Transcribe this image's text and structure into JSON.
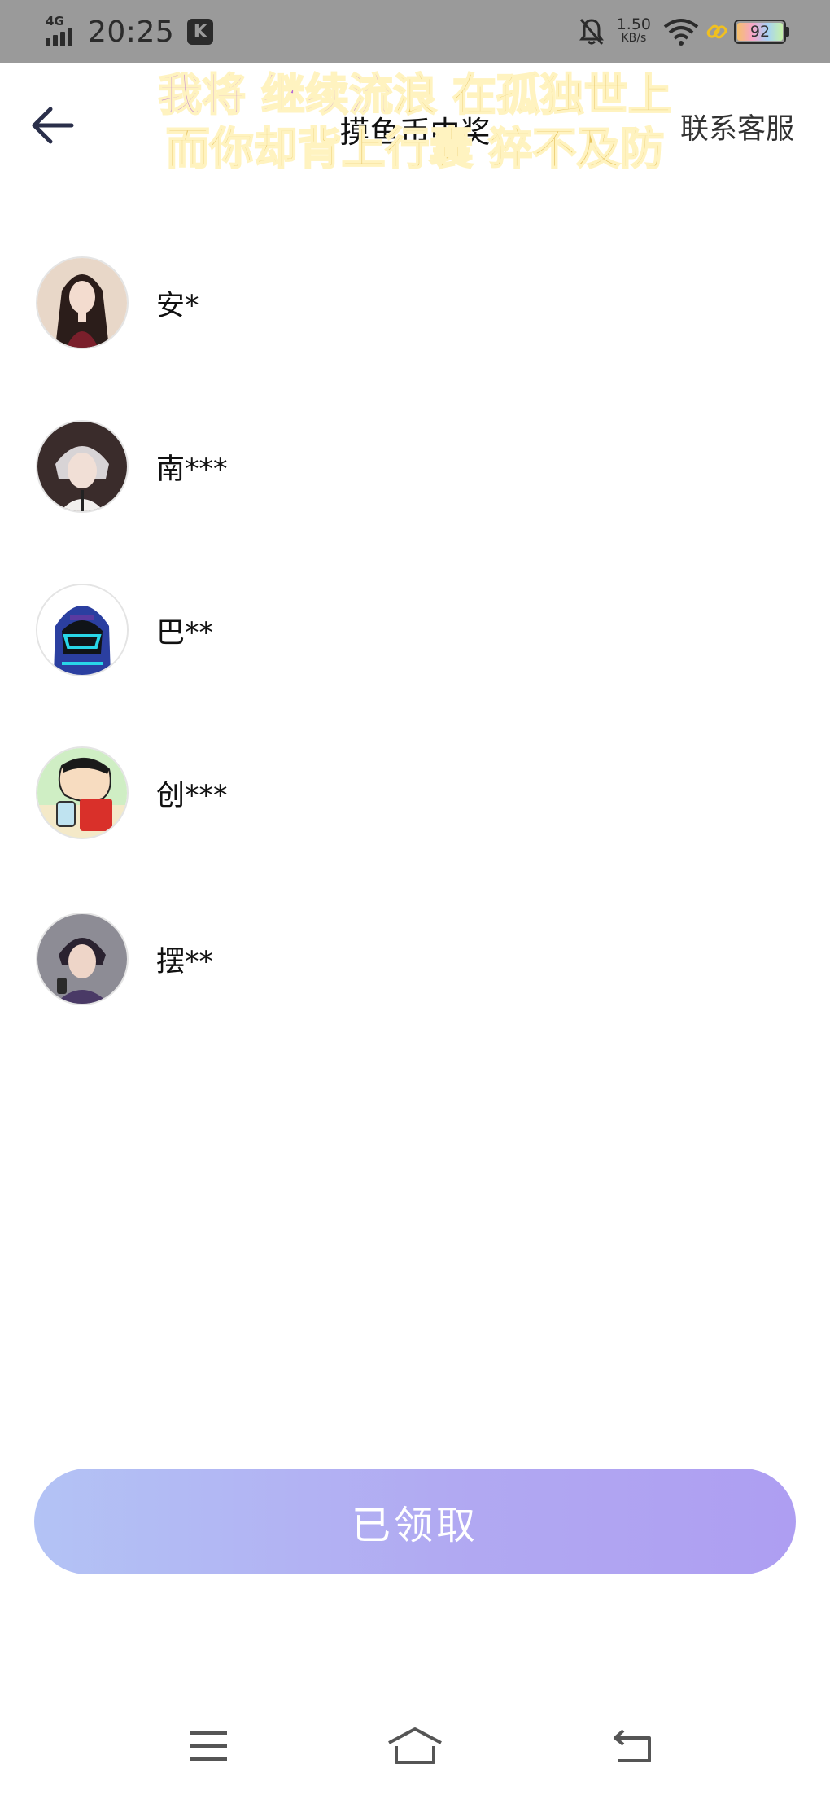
{
  "status_bar": {
    "network": "4G",
    "time": "20:25",
    "app_indicator": "K",
    "speed_value": "1.50",
    "speed_unit": "KB/s",
    "battery": "92"
  },
  "header": {
    "title": "摸鱼币中奖",
    "contact_label": "联系客服"
  },
  "lyrics": {
    "line1_purple": "我将 继续流",
    "line1_gold": "浪 在孤独世上",
    "line2": "而你却背上行囊 猝不及防"
  },
  "winners": [
    {
      "name": "安*",
      "avatar": "avatar-girl"
    },
    {
      "name": "南***",
      "avatar": "avatar-silver-hair-boy"
    },
    {
      "name": "巴**",
      "avatar": "avatar-hooded-figure"
    },
    {
      "name": "创***",
      "avatar": "avatar-cartoon-kid"
    },
    {
      "name": "摆**",
      "avatar": "avatar-dark-hair-boy"
    }
  ],
  "claim_button": {
    "label": "已领取",
    "gradient": [
      "#b3c3f5",
      "#ae9ef2"
    ]
  },
  "nav": {
    "icons": [
      "menu-icon",
      "home-icon",
      "back-nav-icon"
    ]
  }
}
